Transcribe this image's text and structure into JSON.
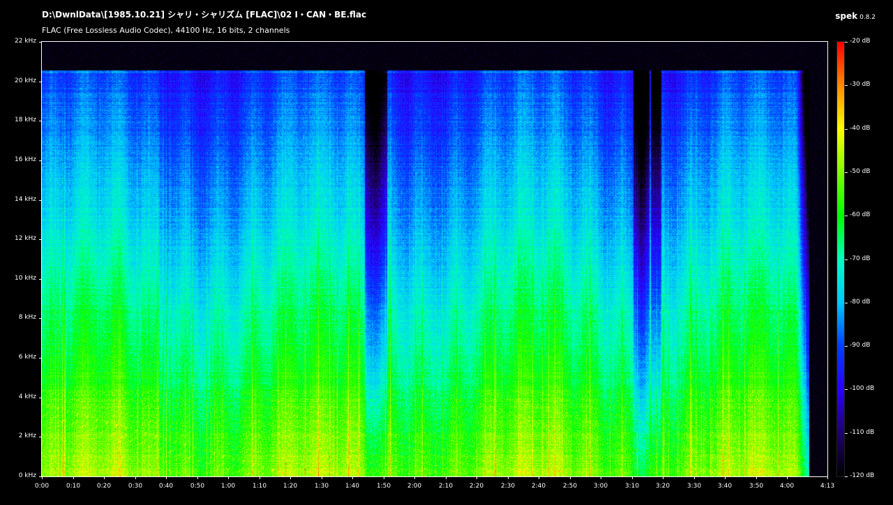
{
  "window": {
    "title": "D:\\DwnlData\\[1985.10.21] シャリ・シャリズム [FLAC]\\02 I・CAN・BE.flac",
    "subtitle": "FLAC (Free Lossless Audio Codec), 44100 Hz, 16 bits, 2 channels",
    "brand": "spek",
    "version": "0.8.2"
  },
  "chart_data": {
    "type": "heatmap",
    "title": "D:\\DwnlData\\[1985.10.21] シャリ・シャリズム [FLAC]\\02 I・CAN・BE.flac",
    "subtitle": "FLAC (Free Lossless Audio Codec), 44100 Hz, 16 bits, 2 channels",
    "x_axis": {
      "range_seconds": [
        0,
        253
      ],
      "tick_labels": [
        "0:00",
        "0:10",
        "0:20",
        "0:30",
        "0:40",
        "0:50",
        "1:00",
        "1:10",
        "1:20",
        "1:30",
        "1:40",
        "1:50",
        "2:00",
        "2:10",
        "2:20",
        "2:30",
        "2:40",
        "2:50",
        "3:00",
        "3:10",
        "3:20",
        "3:30",
        "3:40",
        "3:50",
        "4:00",
        "4:13"
      ],
      "tick_seconds": [
        0,
        10,
        20,
        30,
        40,
        50,
        60,
        70,
        80,
        90,
        100,
        110,
        120,
        130,
        140,
        150,
        160,
        170,
        180,
        190,
        200,
        210,
        220,
        230,
        240,
        253
      ]
    },
    "y_axis": {
      "range_khz": [
        0,
        22
      ],
      "tick_labels": [
        "0 kHz",
        "2 kHz",
        "4 kHz",
        "6 kHz",
        "8 kHz",
        "10 kHz",
        "12 kHz",
        "14 kHz",
        "16 kHz",
        "18 kHz",
        "20 kHz",
        "22 kHz"
      ],
      "tick_values": [
        0,
        2,
        4,
        6,
        8,
        10,
        12,
        14,
        16,
        18,
        20,
        22
      ]
    },
    "colorbar": {
      "range_db": [
        -120,
        -20
      ],
      "tick_labels": [
        "-20 dB",
        "-30 dB",
        "-40 dB",
        "-50 dB",
        "-60 dB",
        "-70 dB",
        "-80 dB",
        "-90 dB",
        "-100 dB",
        "-110 dB",
        "-120 dB"
      ],
      "tick_values": [
        -20,
        -30,
        -40,
        -50,
        -60,
        -70,
        -80,
        -90,
        -100,
        -110,
        -120
      ],
      "colors": [
        "#ff0000",
        "#ff8c00",
        "#ffff00",
        "#7fff00",
        "#00ff00",
        "#00ffc0",
        "#00c8ff",
        "#0040ff",
        "#2a00ff",
        "#200070",
        "#000000"
      ]
    },
    "features": {
      "lowpass_cutoff_khz": 20.5,
      "fade_out_start_seconds": 243,
      "dropouts_seconds": [
        [
          104,
          111
        ],
        [
          190.5,
          195.5
        ],
        [
          196,
          199.5
        ]
      ],
      "silence_end_seconds": 247
    }
  }
}
